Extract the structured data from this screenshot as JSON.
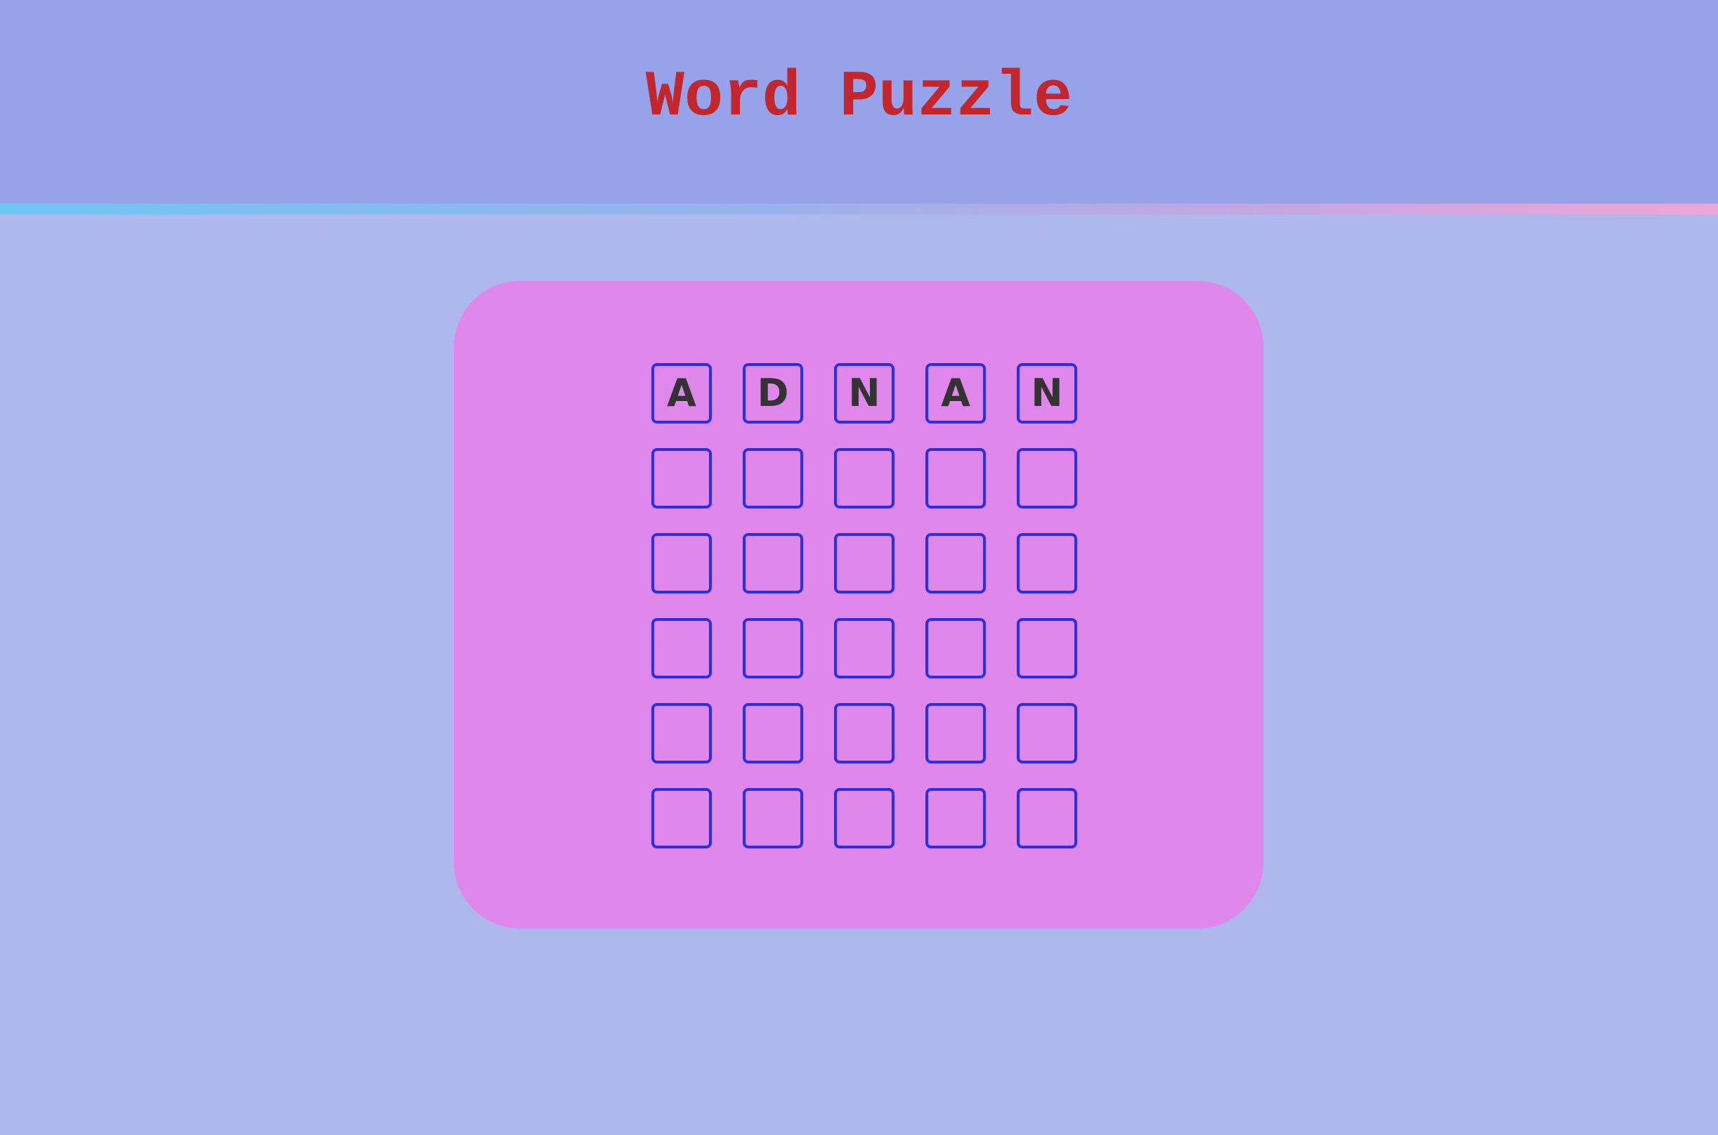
{
  "app": {
    "title": "Word Puzzle"
  },
  "colors": {
    "background": "#aeb8ec",
    "header": "#96a3eb",
    "title": "#c1272d",
    "board": "#e087ec",
    "tile_border": "#2b2fe0",
    "letter": "#333333"
  },
  "grid": {
    "columns": 5,
    "rows": [
      [
        "A",
        "D",
        "N",
        "A",
        "N"
      ],
      [
        "",
        "",
        "",
        "",
        ""
      ],
      [
        "",
        "",
        "",
        "",
        ""
      ],
      [
        "",
        "",
        "",
        "",
        ""
      ],
      [
        "",
        "",
        "",
        "",
        ""
      ],
      [
        "",
        "",
        "",
        "",
        ""
      ]
    ]
  }
}
